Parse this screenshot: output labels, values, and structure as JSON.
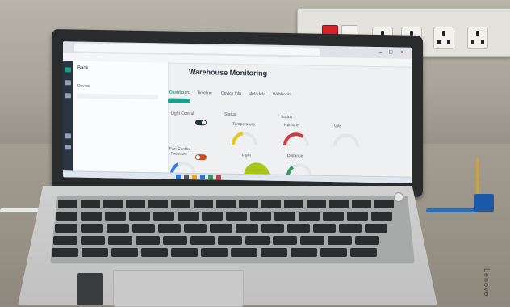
{
  "app": {
    "title": "Warehouse Monitoring",
    "sidebar_title": "Back",
    "device_label": "Device",
    "tabs": [
      "Dashboard",
      "Timeline",
      "Device Info",
      "Metadata",
      "Webhooks"
    ],
    "widgets": {
      "switch_1": "Light Control",
      "switch_2": "Fan Control",
      "status_1": "Status",
      "status_2": "Status"
    },
    "gauges": [
      {
        "label": "Temperature",
        "color": "#e8c71e",
        "value": 0.45
      },
      {
        "label": "Humidity",
        "color": "#d33a3a",
        "value": 0.7
      },
      {
        "label": "Gas",
        "color": "#cfd3d6",
        "value": 0.0
      },
      {
        "label": "Pressure",
        "color": "#3a7bd5",
        "value": 0.35
      },
      {
        "label": "Light",
        "color": "#a9c51a",
        "value": 0.55
      },
      {
        "label": "Distance",
        "color": "#2e9e58",
        "value": 0.3
      }
    ]
  },
  "laptop": {
    "brand": "Lenovo"
  },
  "colors": {
    "accent": "#1f9e8a",
    "outlet_switch": "#d8232a"
  },
  "icons": [
    "power-icon",
    "windows-icon",
    "browser-icon"
  ]
}
